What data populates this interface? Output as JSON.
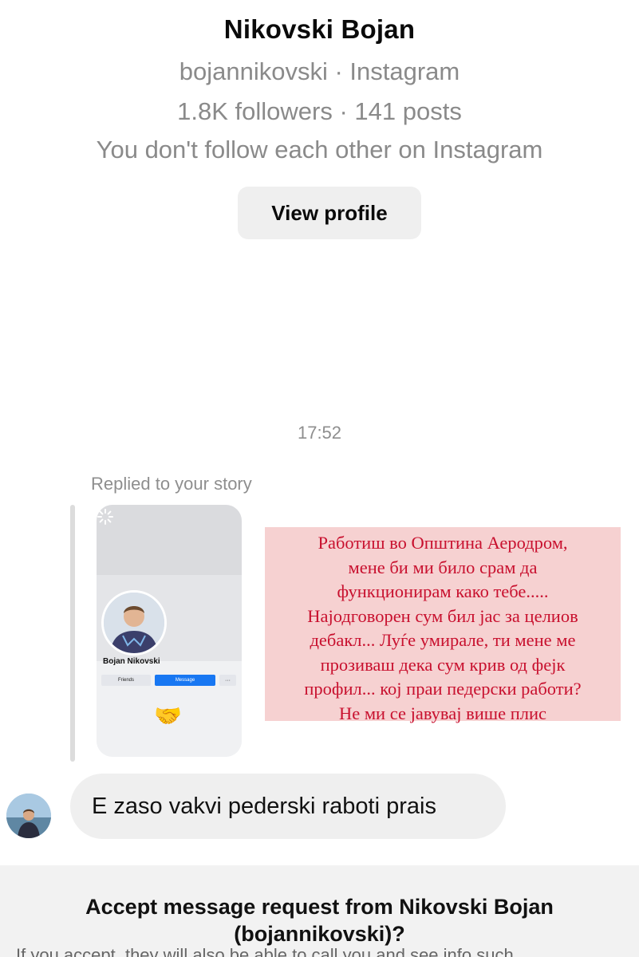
{
  "profile": {
    "name": "Nikovski Bojan",
    "handle_line": "bojannikovski · Instagram",
    "stats_line": "1.8K followers · 141 posts",
    "follow_status": "You don't follow each other on Instagram",
    "view_profile_label": "View profile"
  },
  "conversation": {
    "timestamp": "17:52",
    "reply_label": "Replied to your story",
    "story": {
      "name": "Bojan Nikovski",
      "friends_label": "Friends",
      "message_label": "Message",
      "more_label": "···",
      "emoji": "🤝"
    },
    "note_lines": [
      "Работиш во Општина Аеродром,",
      "мене би ми било срам да",
      "функционирам како тебе.....",
      "Најодговорен сум бил јас за целиов",
      "дебакл... Луѓе умирале, ти мене ме",
      "прозиваш дека сум крив од фејк",
      "профил... кој праи педерски работи?",
      "Не ми се јавувај више плис"
    ],
    "message": "E zaso vakvi pederski raboti prais"
  },
  "request": {
    "title_line1": "Accept message request from Nikovski Bojan",
    "title_line2": "(bojannikovski)?",
    "description": "If you accept, they will also be able to call you and see info such"
  },
  "colors": {
    "note_bg": "#f6d1d1",
    "note_text": "#c8102e",
    "bubble_bg": "#efefef",
    "message_button": "#1877f2"
  }
}
